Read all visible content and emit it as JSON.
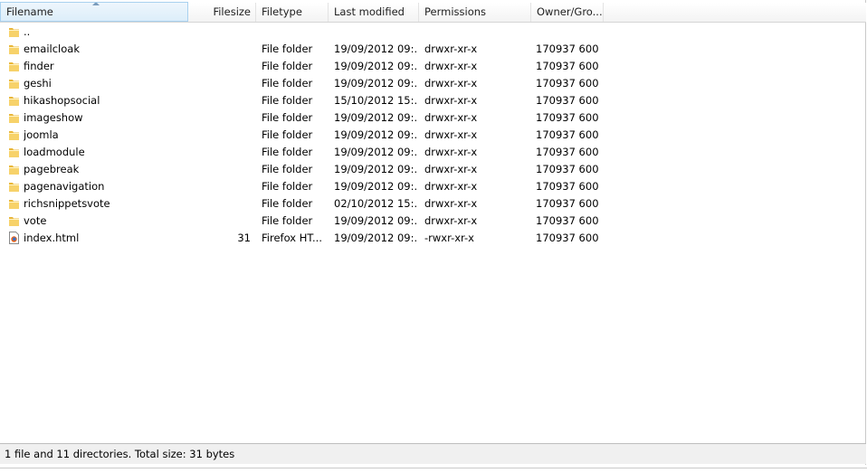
{
  "columns": {
    "filename": "Filename",
    "filesize": "Filesize",
    "filetype": "Filetype",
    "last_modified": "Last modified",
    "permissions": "Permissions",
    "owner_group": "Owner/Gro..."
  },
  "rows": [
    {
      "name": "..",
      "size": "",
      "type": "",
      "modified": "",
      "permissions": "",
      "owner": "",
      "icon": "folder-icon"
    },
    {
      "name": "emailcloak",
      "size": "",
      "type": "File folder",
      "modified": "19/09/2012 09:...",
      "permissions": "drwxr-xr-x",
      "owner": "170937 600",
      "icon": "folder-icon"
    },
    {
      "name": "finder",
      "size": "",
      "type": "File folder",
      "modified": "19/09/2012 09:...",
      "permissions": "drwxr-xr-x",
      "owner": "170937 600",
      "icon": "folder-icon"
    },
    {
      "name": "geshi",
      "size": "",
      "type": "File folder",
      "modified": "19/09/2012 09:...",
      "permissions": "drwxr-xr-x",
      "owner": "170937 600",
      "icon": "folder-icon"
    },
    {
      "name": "hikashopsocial",
      "size": "",
      "type": "File folder",
      "modified": "15/10/2012 15:...",
      "permissions": "drwxr-xr-x",
      "owner": "170937 600",
      "icon": "folder-icon"
    },
    {
      "name": "imageshow",
      "size": "",
      "type": "File folder",
      "modified": "19/09/2012 09:...",
      "permissions": "drwxr-xr-x",
      "owner": "170937 600",
      "icon": "folder-icon"
    },
    {
      "name": "joomla",
      "size": "",
      "type": "File folder",
      "modified": "19/09/2012 09:...",
      "permissions": "drwxr-xr-x",
      "owner": "170937 600",
      "icon": "folder-icon"
    },
    {
      "name": "loadmodule",
      "size": "",
      "type": "File folder",
      "modified": "19/09/2012 09:...",
      "permissions": "drwxr-xr-x",
      "owner": "170937 600",
      "icon": "folder-icon"
    },
    {
      "name": "pagebreak",
      "size": "",
      "type": "File folder",
      "modified": "19/09/2012 09:...",
      "permissions": "drwxr-xr-x",
      "owner": "170937 600",
      "icon": "folder-icon"
    },
    {
      "name": "pagenavigation",
      "size": "",
      "type": "File folder",
      "modified": "19/09/2012 09:...",
      "permissions": "drwxr-xr-x",
      "owner": "170937 600",
      "icon": "folder-icon"
    },
    {
      "name": "richsnippetsvote",
      "size": "",
      "type": "File folder",
      "modified": "02/10/2012 15:...",
      "permissions": "drwxr-xr-x",
      "owner": "170937 600",
      "icon": "folder-icon"
    },
    {
      "name": "vote",
      "size": "",
      "type": "File folder",
      "modified": "19/09/2012 09:...",
      "permissions": "drwxr-xr-x",
      "owner": "170937 600",
      "icon": "folder-icon"
    },
    {
      "name": "index.html",
      "size": "31",
      "type": "Firefox HT...",
      "modified": "19/09/2012 09:...",
      "permissions": "-rwxr-xr-x",
      "owner": "170937 600",
      "icon": "firefox-html-icon"
    }
  ],
  "status": {
    "text": "1 file and 11 directories. Total size: 31 bytes"
  },
  "colors": {
    "folder": "#f4c64a",
    "header_sorted": "#dceefa"
  }
}
